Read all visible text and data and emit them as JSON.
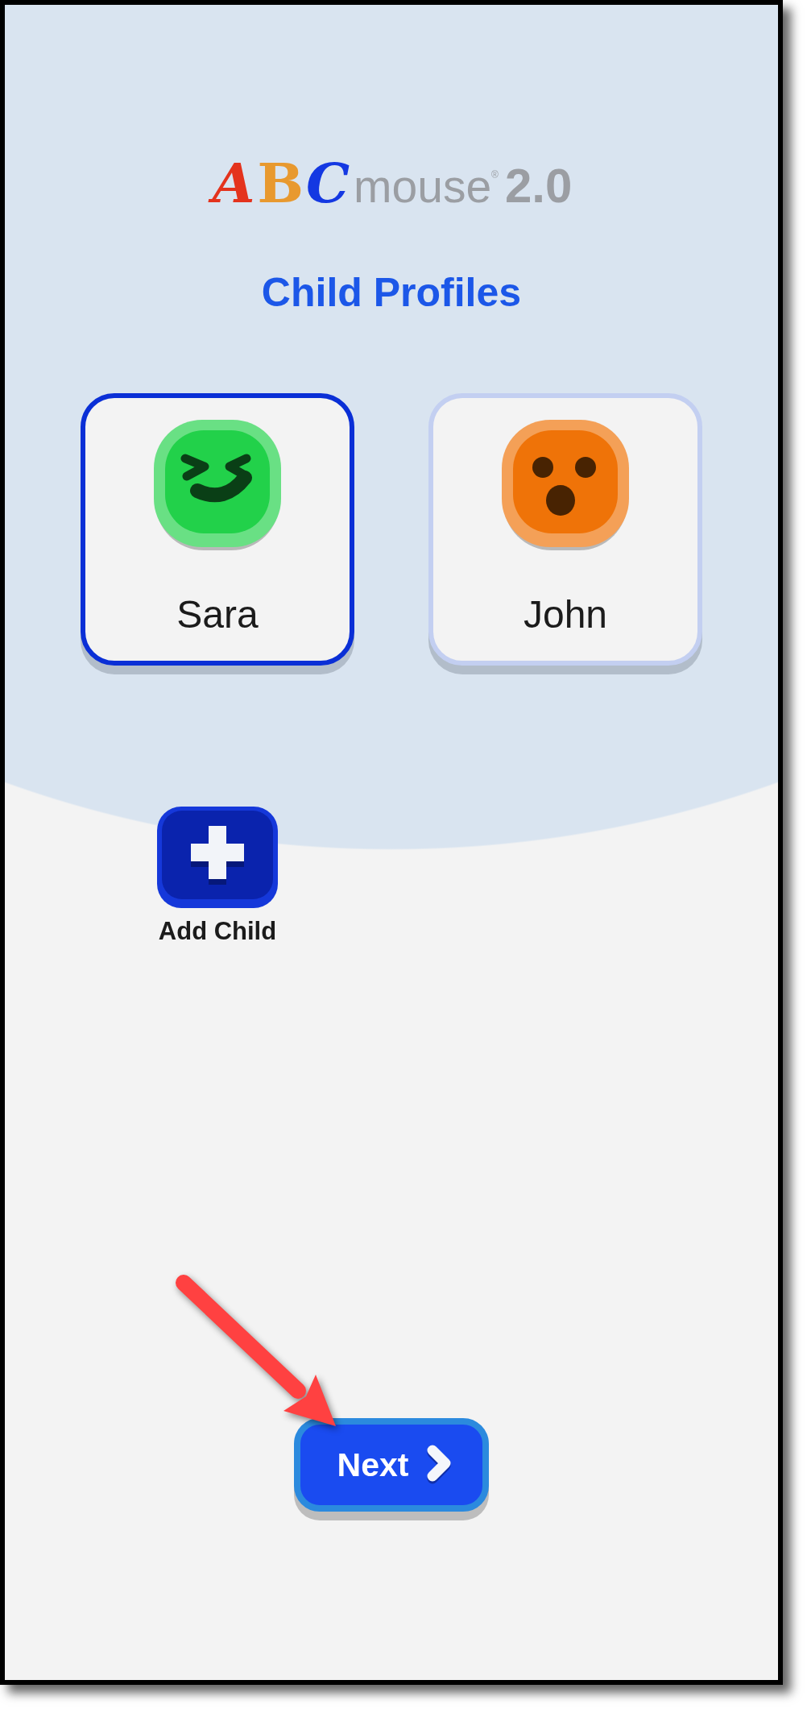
{
  "logo": {
    "letters": "ABC",
    "word": "mouse",
    "registered": "®",
    "version": "2.0"
  },
  "title": "Child Profiles",
  "profiles": [
    {
      "name": "Sara",
      "selected": true,
      "avatar": {
        "kind": "laughing",
        "color": "#22d14a"
      }
    },
    {
      "name": "John",
      "selected": false,
      "avatar": {
        "kind": "surprised",
        "color": "#ef7308"
      }
    }
  ],
  "add_child": {
    "label": "Add Child"
  },
  "next_button": {
    "label": "Next"
  }
}
